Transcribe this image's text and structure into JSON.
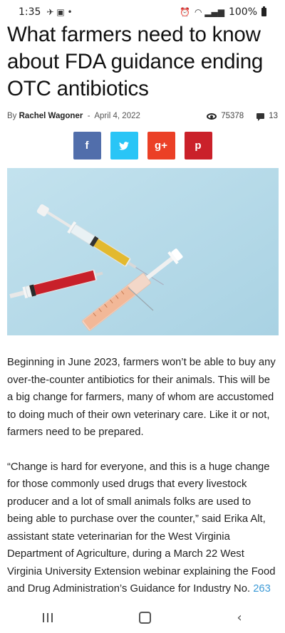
{
  "status_bar": {
    "time": "1:35",
    "battery": "100%"
  },
  "article": {
    "title": "What farmers need to know about FDA guidance ending OTC antibiotics",
    "by_label": "By",
    "author": "Rachel Wagoner",
    "separator": "-",
    "date": "April 4, 2022",
    "views": "75378",
    "comments": "13",
    "paragraphs": [
      "Beginning in June 2023, farmers won’t be able to buy any over-the-counter antibiotics for their animals. This will be a big change for farmers, many of whom are accustomed to doing much of their own veterinary care. Like it or not, farmers need to be prepared.",
      "“Change is hard for everyone, and this is a huge change for those commonly used drugs that every livestock producer and a lot of small animals folks are used to being able to purchase over the counter,” said Erika Alt, assistant state veterinarian for the West Virginia Department of Agriculture, during a March 22 West Virginia University Extension webinar explaining the Food and Drug Administration’s Guidance for Industry No."
    ],
    "link_text": "263"
  },
  "share": {
    "facebook": "f",
    "twitter": "t",
    "googleplus": "g+",
    "pinterest": "p"
  },
  "colors": {
    "facebook": "#516eab",
    "twitter": "#29c5f6",
    "googleplus": "#eb4026",
    "pinterest": "#ca212a",
    "link": "#3c9ad6"
  }
}
